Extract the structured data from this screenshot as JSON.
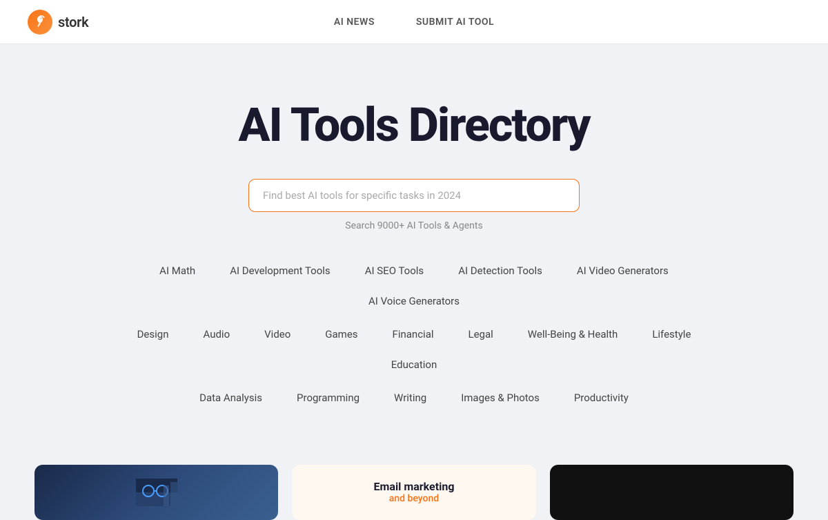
{
  "header": {
    "logo_text": "stork",
    "nav_items": [
      {
        "id": "ai-news",
        "label": "AI NEWS"
      },
      {
        "id": "submit-ai-tool",
        "label": "SUBMIT AI TOOL"
      }
    ]
  },
  "hero": {
    "title": "AI Tools Directory",
    "search_placeholder": "Find best AI tools for specific tasks in 2024",
    "search_subtitle": "Search 9000+ AI Tools & Agents"
  },
  "categories": {
    "row1": [
      "AI Math",
      "AI Development Tools",
      "AI SEO Tools",
      "AI Detection Tools",
      "AI Video Generators",
      "AI Voice Generators"
    ],
    "row2": [
      "Design",
      "Audio",
      "Video",
      "Games",
      "Financial",
      "Legal",
      "Well-Being & Health",
      "Lifestyle",
      "Education"
    ],
    "row3": [
      "Data Analysis",
      "Programming",
      "Writing",
      "Images & Photos",
      "Productivity"
    ]
  },
  "cards": {
    "center_title": "Email marketing",
    "center_subtitle": "and beyond"
  }
}
